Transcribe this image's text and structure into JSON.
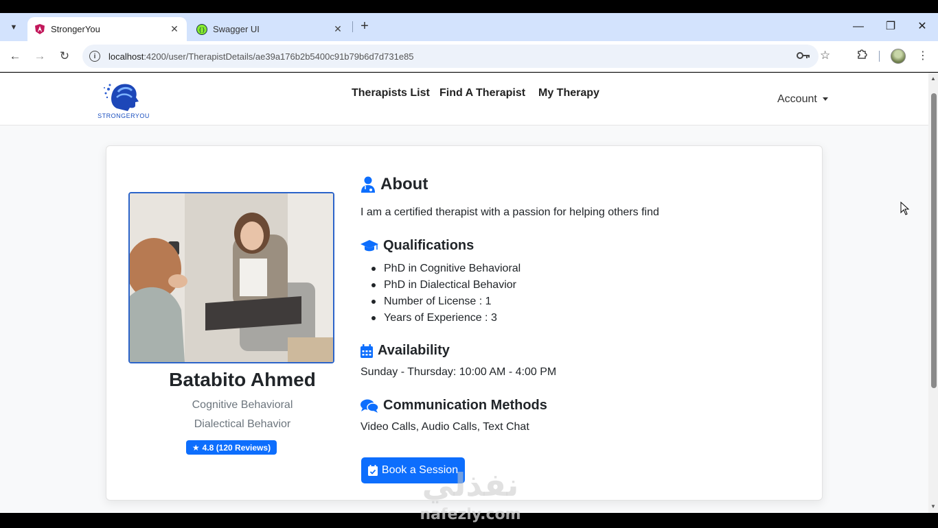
{
  "browser": {
    "tabs": [
      {
        "title": "StrongerYou",
        "active": true
      },
      {
        "title": "Swagger UI",
        "active": false
      }
    ],
    "url_host": "localhost",
    "url_path": ":4200/user/TherapistDetails/ae39a176b2b5400c91b79b6d7d731e85"
  },
  "nav": {
    "logo_text": "STRONGERYOU",
    "links": [
      "Therapists List",
      "Find A Therapist",
      "My Therapy"
    ],
    "account_label": "Account"
  },
  "profile": {
    "name": "Batabito Ahmed",
    "specialties": [
      "Cognitive Behavioral",
      "Dialectical Behavior"
    ],
    "rating": "4.8 (120 Reviews)"
  },
  "about": {
    "heading": "About",
    "text": "I am a certified therapist with a passion for helping others find"
  },
  "qualifications": {
    "heading": "Qualifications",
    "items": [
      "PhD in Cognitive Behavioral",
      "PhD in Dialectical Behavior",
      "Number of License : 1",
      "Years of Experience : 3"
    ]
  },
  "availability": {
    "heading": "Availability",
    "text": "Sunday - Thursday: 10:00 AM - 4:00 PM"
  },
  "communication": {
    "heading": "Communication Methods",
    "text": "Video Calls, Audio Calls, Text Chat"
  },
  "actions": {
    "book_label": "Book a Session"
  },
  "watermark": {
    "arabic": "نفذلي",
    "latin": "nafezly.com"
  },
  "colors": {
    "primary": "#0d6efd",
    "tabstrip": "#d3e3fd"
  }
}
